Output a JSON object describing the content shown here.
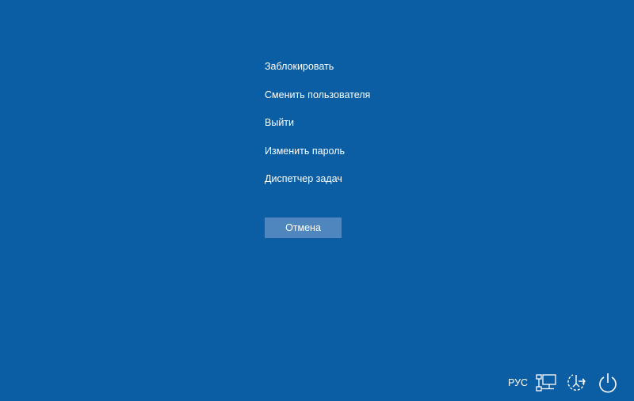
{
  "menu": {
    "items": [
      {
        "label": "Заблокировать"
      },
      {
        "label": "Сменить пользователя"
      },
      {
        "label": "Выйти"
      },
      {
        "label": "Изменить пароль"
      },
      {
        "label": "Диспетчер задач"
      }
    ]
  },
  "cancel_button": {
    "label": "Отмена"
  },
  "tray": {
    "language": "РУС",
    "icons": [
      "network-icon",
      "ease-of-access-icon",
      "power-icon"
    ]
  },
  "colors": {
    "background": "#0c5ea4",
    "button": "#4f86bd",
    "text": "#ffffff"
  }
}
